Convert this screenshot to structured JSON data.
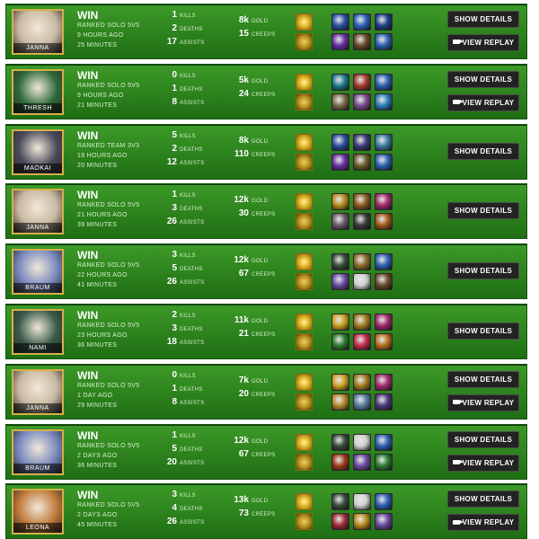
{
  "labels": {
    "kills": "KILLS",
    "deaths": "DEATHS",
    "assists": "ASSISTS",
    "gold": "GOLD",
    "creeps": "CREEPS",
    "show_details": "SHOW DETAILS",
    "view_replay": "VIEW REPLAY"
  },
  "colors": {
    "row_green": "#2e8a1c",
    "button_dark": "#222222",
    "spell_gold": "#e0b62a"
  },
  "matches": [
    {
      "champion": "JANNA",
      "result": "WIN",
      "mode": "RANKED SOLO 5V5",
      "ago": "9 HOURS AGO",
      "duration": "25 MINUTES",
      "kills": "1",
      "deaths": "2",
      "assists": "17",
      "gold": "8k",
      "creeps": "15",
      "replay": true,
      "portrait": "#c9b8a0",
      "items": [
        "#2a4fa0",
        "#2b5fb5",
        "#1b3f85",
        "#6a2fa0",
        "#6b4a2a",
        "#2a5fb0"
      ]
    },
    {
      "champion": "THRESH",
      "result": "WIN",
      "mode": "RANKED SOLO 5V5",
      "ago": "9 HOURS AGO",
      "duration": "21 MINUTES",
      "kills": "0",
      "deaths": "1",
      "assists": "8",
      "gold": "5k",
      "creeps": "24",
      "replay": true,
      "portrait": "#2f6a3a",
      "items": [
        "#1e7a8a",
        "#a03a2a",
        "#2a5fb0",
        "#7a6a4a",
        "#7a4a8a",
        "#2a7ab5"
      ]
    },
    {
      "champion": "MAOKAI",
      "result": "WIN",
      "mode": "RANKED TEAM 3V3",
      "ago": "19 HOURS AGO",
      "duration": "20 MINUTES",
      "kills": "5",
      "deaths": "2",
      "assists": "12",
      "gold": "8k",
      "creeps": "110",
      "replay": false,
      "portrait": "#4a4a5a",
      "items": [
        "#2a4fa0",
        "#3a3a7a",
        "#3a7aa0",
        "#6a2fa0",
        "#6b5a2a",
        "#2a5fb0"
      ]
    },
    {
      "champion": "JANNA",
      "result": "WIN",
      "mode": "RANKED SOLO 5V5",
      "ago": "21 HOURS AGO",
      "duration": "39 MINUTES",
      "kills": "1",
      "deaths": "3",
      "assists": "26",
      "gold": "12k",
      "creeps": "30",
      "replay": false,
      "portrait": "#c9b8a0",
      "items": [
        "#b58a1a",
        "#8a5a20",
        "#a02a6a",
        "#6a5a6a",
        "#3a3a3a",
        "#a0581a"
      ]
    },
    {
      "champion": "BRAUM",
      "result": "WIN",
      "mode": "RANKED SOLO 5V5",
      "ago": "22 HOURS AGO",
      "duration": "41 MINUTES",
      "kills": "3",
      "deaths": "5",
      "assists": "26",
      "gold": "12k",
      "creeps": "67",
      "replay": false,
      "portrait": "#7a8ac0",
      "items": [
        "#3a4a3a",
        "#8a6a2a",
        "#2a5fb0",
        "#6a4aa0",
        "#cfcfcf",
        "#6a4a2a"
      ]
    },
    {
      "champion": "NAMI",
      "result": "WIN",
      "mode": "RANKED SOLO 5V5",
      "ago": "23 HOURS AGO",
      "duration": "36 MINUTES",
      "kills": "2",
      "deaths": "3",
      "assists": "18",
      "gold": "11k",
      "creeps": "21",
      "replay": false,
      "portrait": "#3a5a4a",
      "items": [
        "#c9a020",
        "#a07a20",
        "#a02a6a",
        "#2a7a30",
        "#c02a4a",
        "#b5701a"
      ]
    },
    {
      "champion": "JANNA",
      "result": "WIN",
      "mode": "RANKED SOLO 5V5",
      "ago": "1 DAY AGO",
      "duration": "29 MINUTES",
      "kills": "0",
      "deaths": "1",
      "assists": "8",
      "gold": "7k",
      "creeps": "20",
      "replay": true,
      "portrait": "#c9b8a0",
      "items": [
        "#c9a020",
        "#a07a20",
        "#a02a6a",
        "#b58a2a",
        "#5a7aa0",
        "#4a3a7a"
      ]
    },
    {
      "champion": "BRAUM",
      "result": "WIN",
      "mode": "RANKED SOLO 5V5",
      "ago": "2 DAYS AGO",
      "duration": "36 MINUTES",
      "kills": "1",
      "deaths": "5",
      "assists": "20",
      "gold": "12k",
      "creeps": "67",
      "replay": true,
      "portrait": "#7a8ac0",
      "items": [
        "#3a4a3a",
        "#cfcfcf",
        "#2a5fb0",
        "#a03a1a",
        "#6a4aa0",
        "#2a7a30"
      ]
    },
    {
      "champion": "LEONA",
      "result": "WIN",
      "mode": "RANKED SOLO 5V5",
      "ago": "2 DAYS AGO",
      "duration": "45 MINUTES",
      "kills": "3",
      "deaths": "4",
      "assists": "26",
      "gold": "13k",
      "creeps": "73",
      "replay": true,
      "portrait": "#c07a3a",
      "items": [
        "#3a4a3a",
        "#cfcfcf",
        "#2a5fb0",
        "#a02a3a",
        "#b58a1a",
        "#6a4aa0"
      ]
    }
  ]
}
